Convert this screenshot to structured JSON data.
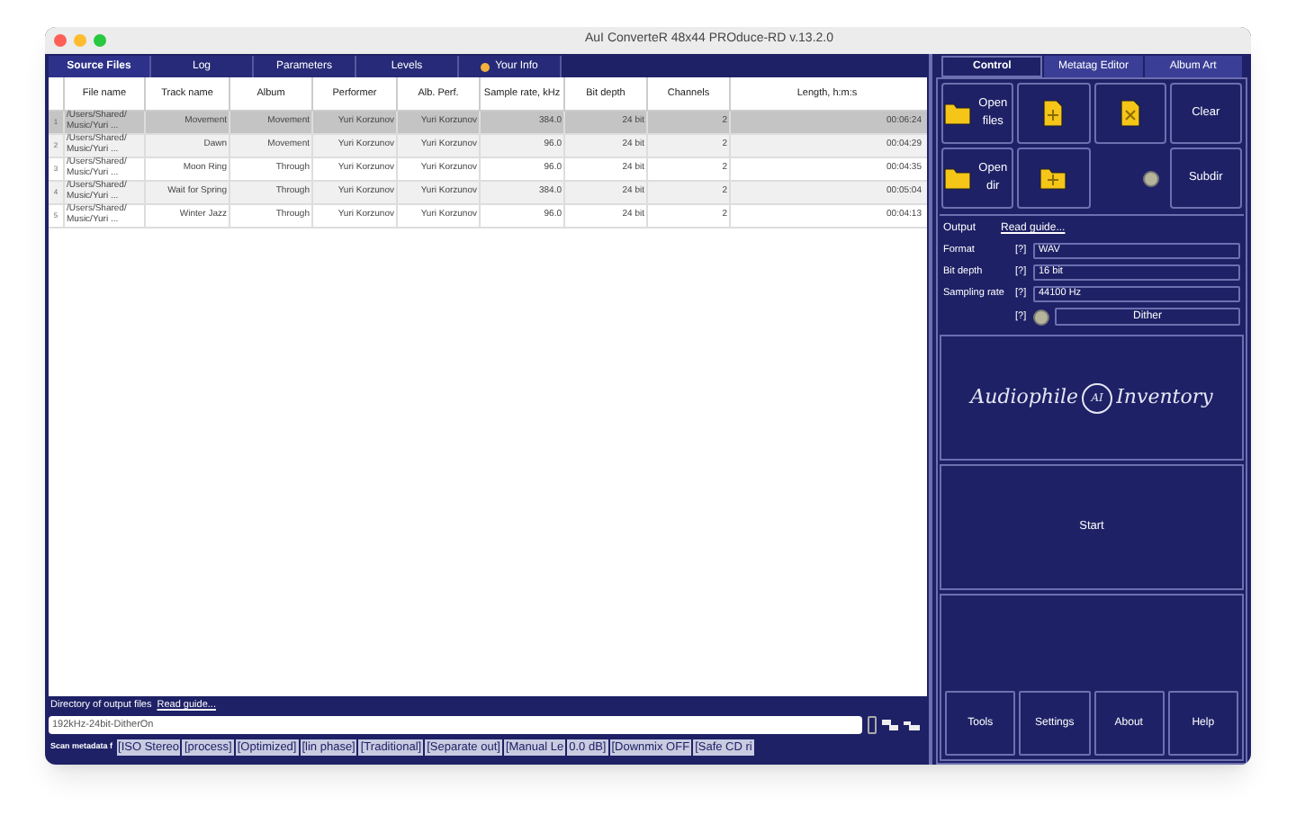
{
  "window": {
    "title": "AuI ConverteR 48x44 PROduce-RD v.13.2.0"
  },
  "left_tabs": [
    {
      "label": "Source Files",
      "selected": true,
      "badge": false
    },
    {
      "label": "Log",
      "selected": false,
      "badge": false
    },
    {
      "label": "Parameters",
      "selected": false,
      "badge": false
    },
    {
      "label": "Levels",
      "selected": false,
      "badge": false
    },
    {
      "label": "Your Info",
      "selected": false,
      "badge": true
    }
  ],
  "table": {
    "columns": [
      "File name",
      "Track name",
      "Album",
      "Performer",
      "Alb. Perf.",
      "Sample rate, kHz",
      "Bit depth",
      "Channels",
      "Length, h:m:s"
    ],
    "rows": [
      {
        "index": "1",
        "selected": true,
        "cells": [
          "/Users/Shared/ Music/Yuri ...",
          "Movement",
          "Movement",
          "Yuri Korzunov",
          "Yuri Korzunov",
          "384.0",
          "24 bit",
          "2",
          "00:06:24"
        ]
      },
      {
        "index": "2",
        "selected": false,
        "cells": [
          "/Users/Shared/ Music/Yuri ...",
          "Dawn",
          "Movement",
          "Yuri Korzunov",
          "Yuri Korzunov",
          "96.0",
          "24 bit",
          "2",
          "00:04:29"
        ]
      },
      {
        "index": "3",
        "selected": false,
        "cells": [
          "/Users/Shared/ Music/Yuri ...",
          "Moon Ring",
          "Through",
          "Yuri Korzunov",
          "Yuri Korzunov",
          "96.0",
          "24 bit",
          "2",
          "00:04:35"
        ]
      },
      {
        "index": "4",
        "selected": false,
        "cells": [
          "/Users/Shared/ Music/Yuri ...",
          "Wait for Spring",
          "Through",
          "Yuri Korzunov",
          "Yuri Korzunov",
          "384.0",
          "24 bit",
          "2",
          "00:05:04"
        ]
      },
      {
        "index": "5",
        "selected": false,
        "cells": [
          "/Users/Shared/ Music/Yuri ...",
          "Winter Jazz",
          "Through",
          "Yuri Korzunov",
          "Yuri Korzunov",
          "96.0",
          "24 bit",
          "2",
          "00:04:13"
        ]
      }
    ]
  },
  "output_dir": {
    "label": "Directory of output files",
    "link": "Read guide...",
    "value": "192kHz-24bit-DitherOn"
  },
  "status_bar": [
    {
      "kind": "title",
      "text": "Scan metadata f"
    },
    {
      "kind": "item",
      "text": "[ISO Stereo"
    },
    {
      "kind": "item",
      "text": "[process]"
    },
    {
      "kind": "item",
      "text": "[Optimized]"
    },
    {
      "kind": "item",
      "text": "[lin phase]"
    },
    {
      "kind": "item",
      "text": "[Traditional]"
    },
    {
      "kind": "item",
      "text": "[Separate out]"
    },
    {
      "kind": "item",
      "text": "[Manual Le"
    },
    {
      "kind": "item",
      "text": "0.0 dB]"
    },
    {
      "kind": "item",
      "text": "[Downmix OFF"
    },
    {
      "kind": "item",
      "text": "[Safe CD ri"
    }
  ],
  "right_tabs": [
    {
      "label": "Control",
      "selected": true
    },
    {
      "label": "Metatag Editor",
      "selected": false
    },
    {
      "label": "Album Art",
      "selected": false
    }
  ],
  "file_buttons": [
    {
      "kind": "folder",
      "label": "Open files"
    },
    {
      "kind": "file-plus"
    },
    {
      "kind": "file-x"
    },
    {
      "kind": "text",
      "label": "Clear"
    },
    {
      "kind": "folder",
      "label": "Open dir"
    },
    {
      "kind": "folder-plus"
    },
    {
      "kind": "toggle"
    },
    {
      "kind": "text",
      "label": "Subdir"
    }
  ],
  "output": {
    "label": "Output",
    "link": "Read guide...",
    "settings": [
      {
        "label": "Format",
        "help": "[?]",
        "value": "WAV"
      },
      {
        "label": "Bit depth",
        "help": "[?]",
        "value": "16 bit"
      },
      {
        "label": "Sampling rate",
        "help": "[?]",
        "value": "44100 Hz"
      }
    ],
    "dither": {
      "help": "[?]",
      "label": "Dither"
    }
  },
  "logo": {
    "left": "Audiophile",
    "monogram": "AI",
    "right": "Inventory"
  },
  "start_button": "Start",
  "bottom_buttons": [
    "Tools",
    "Settings",
    "About",
    "Help"
  ]
}
